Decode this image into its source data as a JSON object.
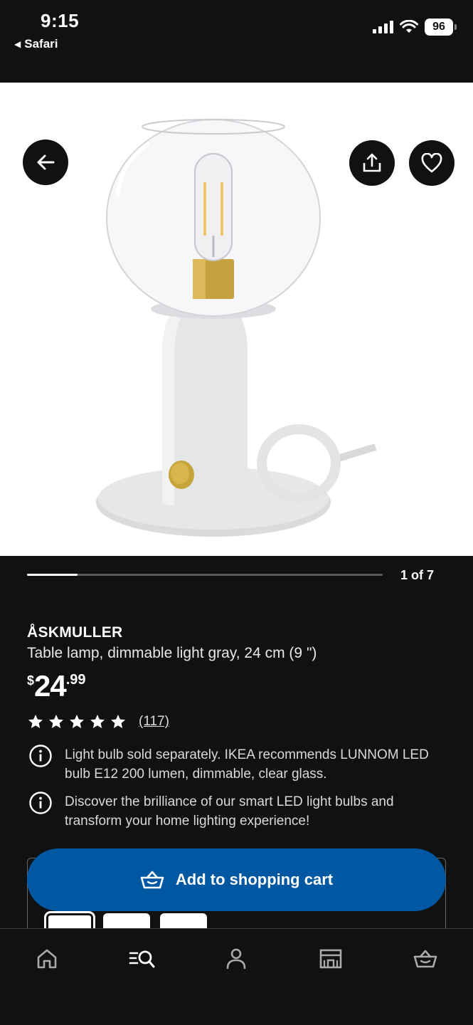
{
  "status_bar": {
    "time": "9:15",
    "back_app": "Safari",
    "battery": "96",
    "icons": [
      "signal-icon",
      "wifi-icon",
      "battery-icon"
    ]
  },
  "top_actions": {
    "icons": [
      "arrow-left-icon",
      "share-icon",
      "heart-icon"
    ]
  },
  "carousel": {
    "counter": "1 of 7",
    "position": 1,
    "total": 7
  },
  "product": {
    "name": "ÅSKMULLER",
    "description": "Table lamp, dimmable light gray, 24 cm (9 \")",
    "price": {
      "currency": "$",
      "integer": "24",
      "decimal": ".99"
    },
    "rating": {
      "stars": 5,
      "reviews": "(117)"
    }
  },
  "notices": [
    {
      "icon": "info-icon",
      "text": "Light bulb sold separately. IKEA recommends LUNNOM LED bulb E12 200 lumen, dimmable, clear glass."
    },
    {
      "icon": "info-icon",
      "text": "Discover the brilliance of our smart LED light bulbs and transform your home lighting experience!"
    }
  ],
  "cart": {
    "button_label": "Add to shopping cart",
    "icon": "shopping-basket-icon",
    "accent": "#0058a3"
  },
  "bottom_nav": {
    "items": [
      "home-icon",
      "search-list-icon",
      "person-icon",
      "store-icon",
      "shopping-basket-icon"
    ]
  },
  "colors": {
    "background": "#111111",
    "accent": "#0058a3",
    "text": "#ffffff"
  }
}
